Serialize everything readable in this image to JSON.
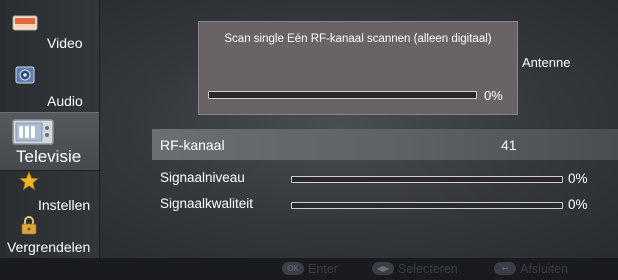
{
  "sidebar": {
    "items": [
      {
        "label": "Video",
        "icon": "video-icon"
      },
      {
        "label": "Audio",
        "icon": "audio-icon"
      },
      {
        "label": "Televisie",
        "icon": "television-icon",
        "selected": true
      },
      {
        "label": "Instellen",
        "icon": "star-icon"
      },
      {
        "label": "Vergrendelen",
        "icon": "lock-icon"
      }
    ]
  },
  "popup": {
    "title": "Scan single Eén RF-kanaal scannen (alleen digitaal)",
    "progress": 0,
    "progress_text": "0%"
  },
  "antenne_label": "Antenne",
  "rf": {
    "label": "RF-kanaal",
    "value": "41"
  },
  "signal_level": {
    "label": "Signaalniveau",
    "value": 0,
    "text": "0%"
  },
  "signal_quality": {
    "label": "Signaalkwaliteit",
    "value": 0,
    "text": "0%"
  },
  "footer": {
    "items": [
      {
        "label": "Enter",
        "button": "OK",
        "icon": "ok-button-icon"
      },
      {
        "label": "Selecteren",
        "button": "◀▶",
        "icon": "dpad-icon"
      },
      {
        "label": "Afsluiten",
        "button": "↩",
        "icon": "back-icon"
      }
    ]
  },
  "colors": {
    "background": "#34373b",
    "sidebar": "#2a2d31",
    "popup": "#6a6365",
    "selected_row": "#6b6e72",
    "footer_text": "#3a3d44"
  }
}
